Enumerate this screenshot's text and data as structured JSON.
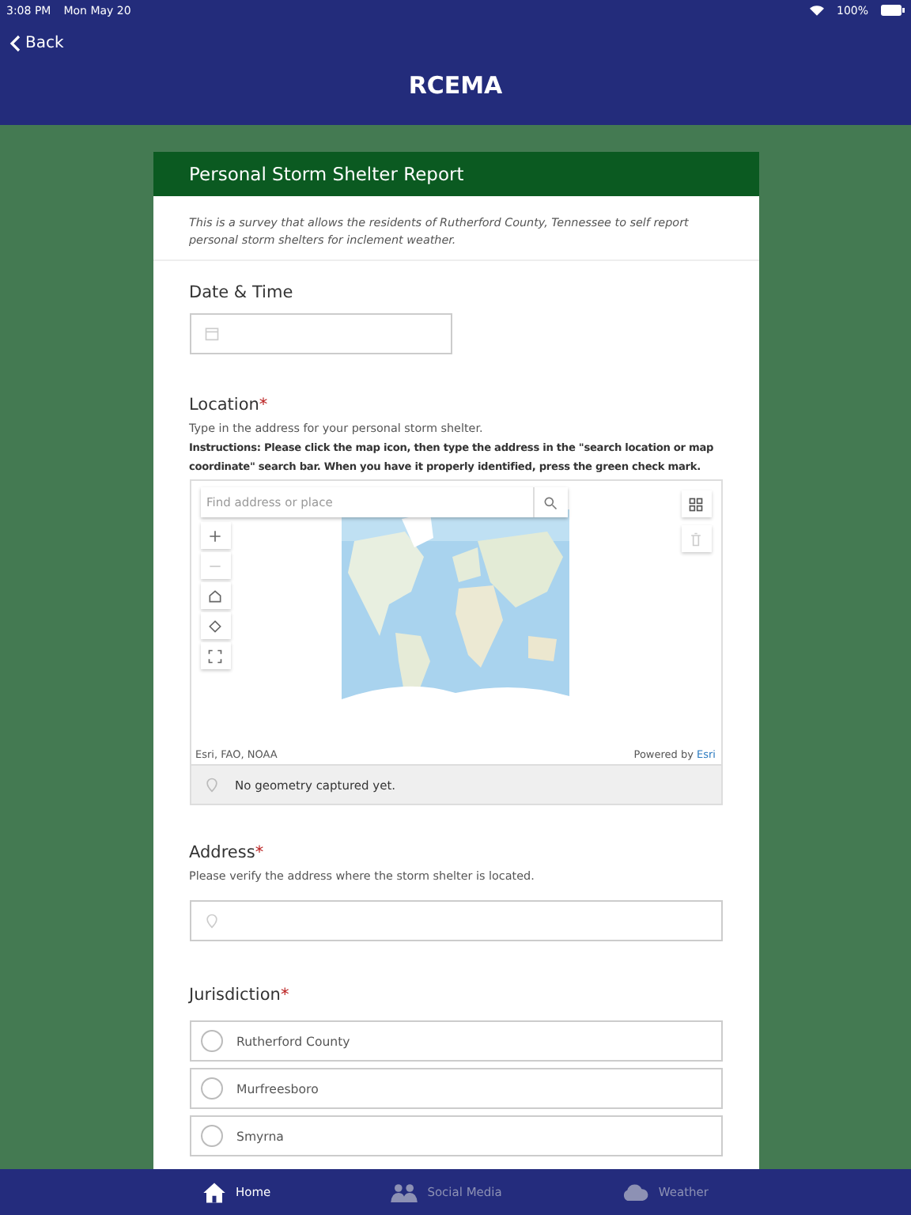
{
  "status_bar": {
    "time": "3:08 PM",
    "date": "Mon May 20",
    "battery": "100%"
  },
  "nav": {
    "back": "Back",
    "title": "RCEMA"
  },
  "form": {
    "title": "Personal Storm Shelter Report",
    "description": "This is a survey that allows the residents of Rutherford County, Tennessee to self report personal storm shelters for inclement weather.",
    "fields": [
      {
        "kind": "datetime",
        "label": "Date & Time"
      },
      {
        "kind": "location",
        "label": "Location",
        "required_mark": "*",
        "hint": "Type in the address for your personal storm shelter.",
        "instructions": "Instructions: Please click the map icon, then type the address in the \"search location or map coordinate\" search bar. When you have it properly identified, press the green check mark.",
        "map": {
          "search_placeholder": "Find address or place",
          "attribution": "Esri, FAO, NOAA",
          "powered_by": "Powered by",
          "powered_link": "Esri",
          "geometry_status": "No geometry captured yet."
        }
      },
      {
        "kind": "address",
        "label": "Address",
        "required_mark": "*",
        "hint": "Please verify the address where the storm shelter is located."
      },
      {
        "kind": "radio",
        "label": "Jurisdiction",
        "required_mark": "*",
        "options": [
          {
            "label": "Rutherford County",
            "selected": false
          },
          {
            "label": "Murfreesboro",
            "selected": false
          },
          {
            "label": "Smyrna",
            "selected": false
          }
        ]
      }
    ]
  },
  "tabs": [
    {
      "label": "Home",
      "kind": "home",
      "selected": true
    },
    {
      "label": "Social Media",
      "kind": "people",
      "selected": false
    },
    {
      "label": "Weather",
      "kind": "cloud",
      "selected": false
    }
  ]
}
